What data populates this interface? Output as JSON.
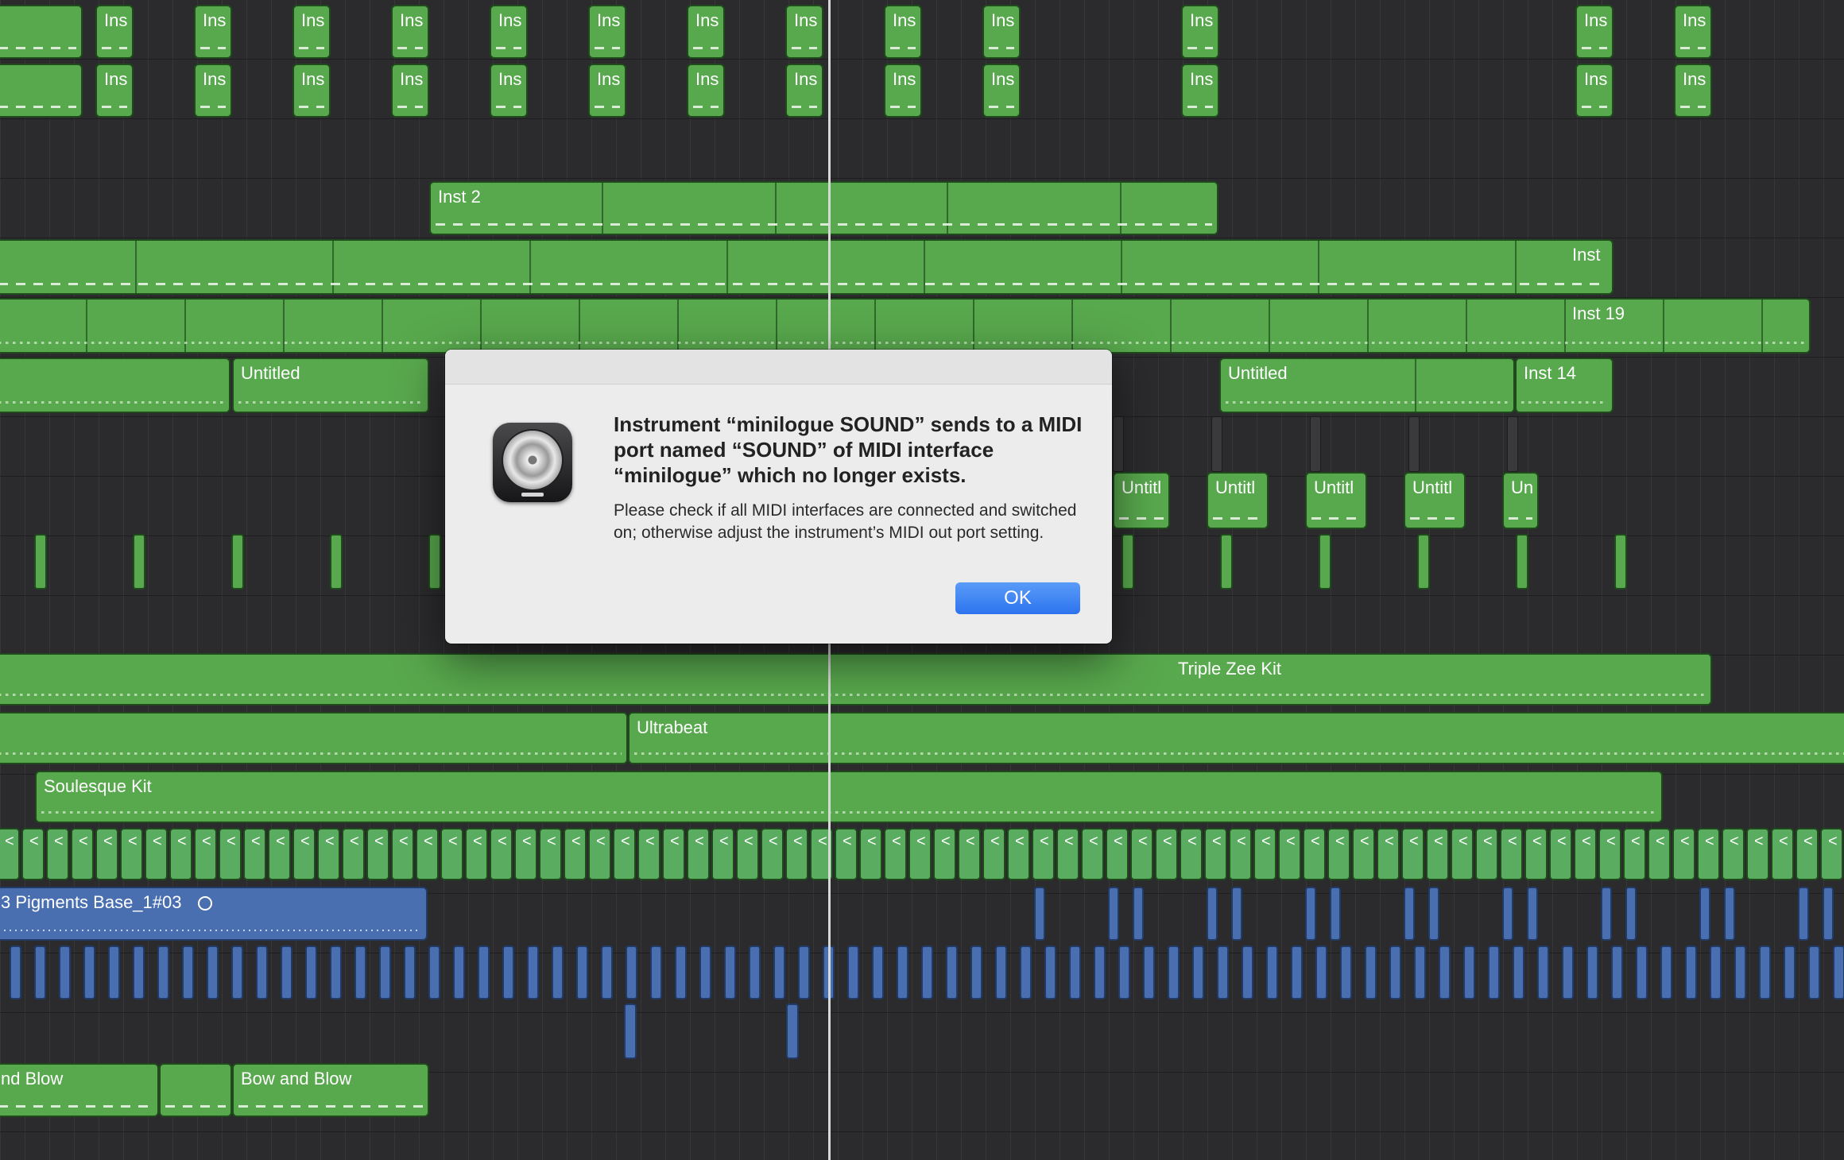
{
  "regions": {
    "ins": "Ins",
    "inst_2": "Inst 2",
    "inst": "Inst",
    "inst_19": "Inst 19",
    "untitled": "Untitled",
    "inst_14": "Inst 14",
    "untitl": "Untitl",
    "un": "Un",
    "triple_zee_kit": "Triple Zee Kit",
    "ultrabeat": "Ultrabeat",
    "soulesque_kit": "Soulesque Kit",
    "loop_glyph": "<",
    "pigments_base": "3 Pigments Base_1#03",
    "nd_blow": "nd Blow",
    "bow_and_blow": "Bow and Blow"
  },
  "dialog": {
    "icon": "logic-pro-icon",
    "message": "Instrument “minilogue SOUND” sends to a MIDI port named “SOUND” of MIDI interface “minilogue” which no longer exists.",
    "info": "Please check if all MIDI interfaces are connected and switched on; otherwise adjust the instrument’s MIDI out port setting.",
    "ok_label": "OK"
  },
  "colors": {
    "background": "#2b2b2d",
    "midi_region": "#58a84d",
    "audio_region": "#4a6fb0",
    "ok_button": "#2d73ee"
  }
}
